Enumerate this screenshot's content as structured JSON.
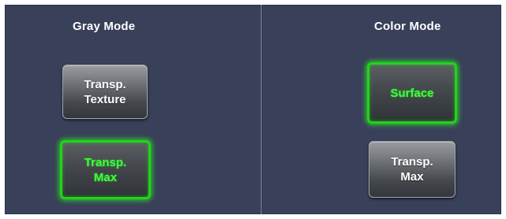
{
  "gray_mode": {
    "title": "Gray Mode",
    "buttons": [
      {
        "label": "Transp.\nTexture",
        "active": false
      },
      {
        "label": "Transp.\nMax",
        "active": true
      }
    ]
  },
  "color_mode": {
    "title": "Color Mode",
    "buttons": [
      {
        "label": "Surface",
        "active": true
      },
      {
        "label": "Transp.\nMax",
        "active": false
      }
    ]
  },
  "colors": {
    "panel_background": "#39405a",
    "active_text": "#3dff3a",
    "active_glow": "#22d31c",
    "normal_text": "#ffffff"
  }
}
